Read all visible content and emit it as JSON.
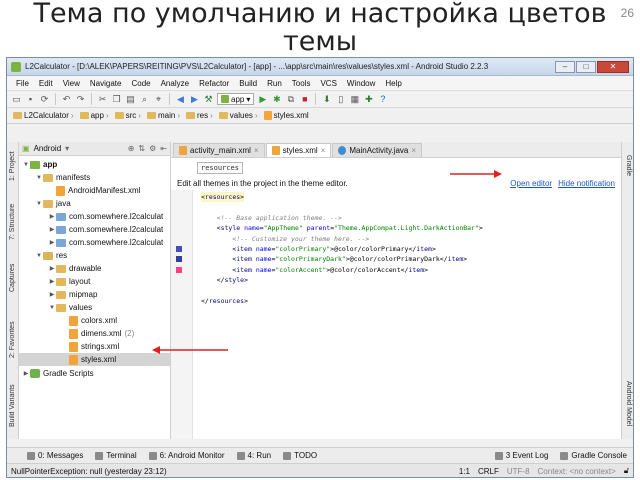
{
  "slide": {
    "title": "Тема по умолчанию и настройка цветов темы",
    "page_number": "26"
  },
  "window": {
    "title": "L2Calculator - [D:\\ALEK\\PAPERS\\REITING\\PVS\\L2Calculator] - [app] - ...\\app\\src\\main\\res\\values\\styles.xml - Android Studio 2.2.3",
    "min": "–",
    "max": "□",
    "close": "✕"
  },
  "menu": [
    {
      "label": "File"
    },
    {
      "label": "Edit"
    },
    {
      "label": "View"
    },
    {
      "label": "Navigate"
    },
    {
      "label": "Code"
    },
    {
      "label": "Analyze"
    },
    {
      "label": "Refactor"
    },
    {
      "label": "Build"
    },
    {
      "label": "Run"
    },
    {
      "label": "Tools"
    },
    {
      "label": "VCS"
    },
    {
      "label": "Window"
    },
    {
      "label": "Help"
    }
  ],
  "toolbar": {
    "run_config": "app",
    "icons": [
      "folder-open-icon",
      "save-icon",
      "sync-icon",
      "back-icon",
      "forward-icon",
      "cut-icon",
      "copy-icon",
      "paste-icon",
      "find-icon",
      "replace-icon",
      "make-icon",
      "run-icon",
      "debug-icon",
      "stop-icon",
      "sdk-icon",
      "avd-icon",
      "help-icon"
    ]
  },
  "breadcrumbs": [
    "L2Calculator",
    "app",
    "src",
    "main",
    "res",
    "values",
    "styles.xml"
  ],
  "left_tool_tabs": [
    "1: Project",
    "7: Structure",
    "Captures",
    "2: Favorites",
    "Build Variants"
  ],
  "right_tool_tabs": [
    "Gradle",
    "Android Model"
  ],
  "project": {
    "view_mode": "Android",
    "tree": [
      {
        "label": "app",
        "depth": 0,
        "icon": "module",
        "open": true
      },
      {
        "label": "manifests",
        "depth": 1,
        "icon": "folder",
        "open": true
      },
      {
        "label": "AndroidManifest.xml",
        "depth": 2,
        "icon": "xml"
      },
      {
        "label": "java",
        "depth": 1,
        "icon": "folder",
        "open": true
      },
      {
        "label": "com.somewhere.l2calculat",
        "depth": 2,
        "icon": "package",
        "open": false
      },
      {
        "label": "com.somewhere.l2calculat",
        "depth": 2,
        "icon": "package",
        "open": false
      },
      {
        "label": "com.somewhere.l2calculat",
        "depth": 2,
        "icon": "package",
        "open": false
      },
      {
        "label": "res",
        "depth": 1,
        "icon": "res",
        "open": true
      },
      {
        "label": "drawable",
        "depth": 2,
        "icon": "folder",
        "open": false
      },
      {
        "label": "layout",
        "depth": 2,
        "icon": "folder",
        "open": false
      },
      {
        "label": "mipmap",
        "depth": 2,
        "icon": "folder",
        "open": false
      },
      {
        "label": "values",
        "depth": 2,
        "icon": "folder",
        "open": true
      },
      {
        "label": "colors.xml",
        "depth": 3,
        "icon": "xml"
      },
      {
        "label": "dimens.xml",
        "depth": 3,
        "icon": "xml",
        "count": "(2)"
      },
      {
        "label": "strings.xml",
        "depth": 3,
        "icon": "xml"
      },
      {
        "label": "styles.xml",
        "depth": 3,
        "icon": "xml",
        "selected": true
      },
      {
        "label": "Gradle Scripts",
        "depth": 0,
        "icon": "gradle",
        "open": false
      }
    ]
  },
  "editor": {
    "tabs": [
      {
        "label": "activity_main.xml",
        "icon": "xml"
      },
      {
        "label": "styles.xml",
        "icon": "xml",
        "active": true
      },
      {
        "label": "MainActivity.java",
        "icon": "class"
      }
    ],
    "tab_close": "×",
    "breadcrumb_tip": "resources",
    "banner_text": "Edit all themes in the project in the theme editor.",
    "open_editor": "Open editor",
    "hide_notification": "Hide notification",
    "code": [
      "<resources>",
      "",
      "    <!-- Base application theme. -->",
      "    <style name=\"AppTheme\" parent=\"Theme.AppCompat.Light.DarkActionBar\">",
      "        <!-- Customize your theme here. -->",
      "        <item name=\"colorPrimary\">@color/colorPrimary</item>",
      "        <item name=\"colorPrimaryDark\">@color/colorPrimaryDark</item>",
      "        <item name=\"colorAccent\">@color/colorAccent</item>",
      "    </style>",
      "",
      "</resources>"
    ],
    "swatch_colors": [
      "#3F51B5",
      "#303F9F",
      "#FF4081"
    ]
  },
  "bottom_tools": [
    {
      "label": "0: Messages"
    },
    {
      "label": "Terminal"
    },
    {
      "label": "6: Android Monitor"
    },
    {
      "label": "4: Run"
    },
    {
      "label": "TODO"
    }
  ],
  "bottom_tools_right": [
    {
      "label": "3 Event Log"
    },
    {
      "label": "Gradle Console"
    }
  ],
  "status": {
    "message": "NullPointerException: null (yesterday 23:12)",
    "position": "1:1",
    "line_sep": "CRLF",
    "encoding": "UTF-8",
    "context": "Context: <no context>"
  },
  "annotation_color": "#e02020"
}
